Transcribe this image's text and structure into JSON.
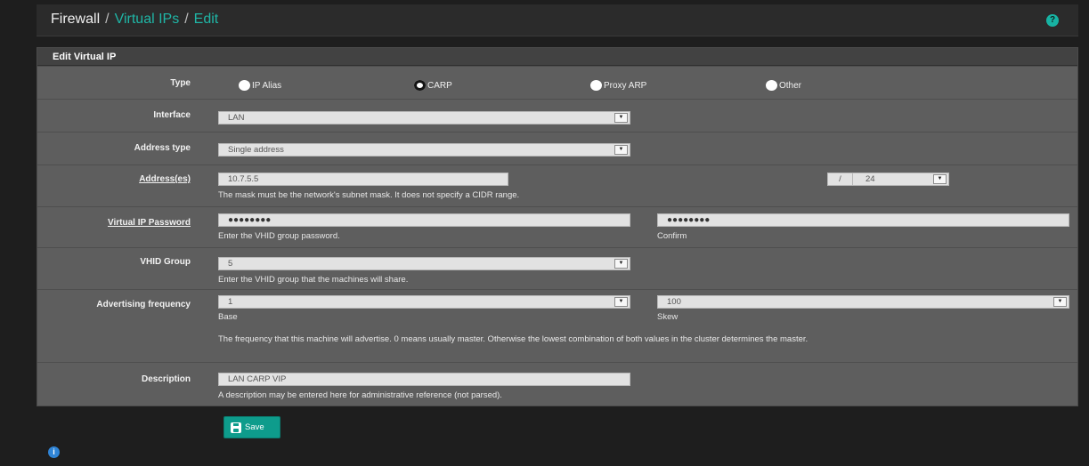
{
  "breadcrumb": {
    "root": "Firewall",
    "sep": "/",
    "item1": "Virtual IPs",
    "item2": "Edit"
  },
  "icons": {
    "help": "help-circle-icon",
    "info": "info-circle-icon",
    "save": "floppy-disk-icon"
  },
  "colors": {
    "accent": "#1fb6a6",
    "button": "#0e9c8c",
    "info": "#2f84d6"
  },
  "panel": {
    "title": "Edit Virtual IP"
  },
  "form": {
    "type": {
      "label": "Type",
      "options": [
        {
          "label": "IP Alias",
          "selected": false
        },
        {
          "label": "CARP",
          "selected": true
        },
        {
          "label": "Proxy ARP",
          "selected": false
        },
        {
          "label": "Other",
          "selected": false
        }
      ]
    },
    "interface": {
      "label": "Interface",
      "value": "LAN"
    },
    "address_type": {
      "label": "Address type",
      "value": "Single address"
    },
    "addresses": {
      "label": "Address(es)",
      "value": "10.7.5.5",
      "help": "The mask must be the network's subnet mask. It does not specify a CIDR range.",
      "mask_prefix": "/",
      "mask": "24"
    },
    "password": {
      "label": "Virtual IP Password",
      "value": "●●●●●●●●",
      "help": "Enter the VHID group password.",
      "confirm_value": "●●●●●●●●",
      "confirm_help": "Confirm"
    },
    "vhid": {
      "label": "VHID Group",
      "value": "5",
      "help": "Enter the VHID group that the machines will share."
    },
    "advertising": {
      "label": "Advertising frequency",
      "base_value": "1",
      "base_help": "Base",
      "skew_value": "100",
      "skew_help": "Skew",
      "help": "The frequency that this machine will advertise. 0 means usually master. Otherwise the lowest combination of both values in the cluster determines the master."
    },
    "description": {
      "label": "Description",
      "value": "LAN CARP VIP",
      "help": "A description may be entered here for administrative reference (not parsed)."
    }
  },
  "save_button": {
    "label": "Save"
  }
}
